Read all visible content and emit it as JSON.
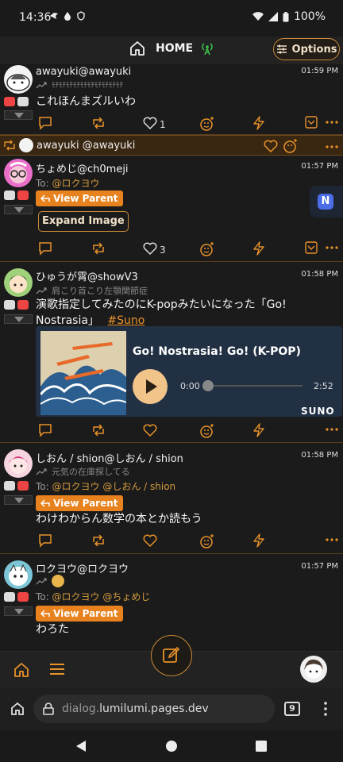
{
  "status": {
    "time": "14:36",
    "battery": "100%"
  },
  "header": {
    "title": "HOME",
    "options_label": "Options"
  },
  "posts": [
    {
      "name": "awayuki@awayuki",
      "time": "01:59 PM",
      "subtitle": "ﾓﾁﾓﾁﾓﾁﾓﾁﾓﾁﾓﾁﾓﾁﾓﾁﾓﾁﾓﾁ",
      "text": "これほんまズルいわ",
      "like_count": "1"
    },
    {
      "repost_by": "awayuki @awayuki",
      "name": "ちょめじ@ch0meji",
      "time": "01:57 PM",
      "to_prefix": "To:",
      "to": "@ロクヨウ",
      "view_parent": "View Parent",
      "expand_image": "Expand Image",
      "like_count": "3"
    },
    {
      "name": "ひゅうが霄@showV3",
      "time": "01:58 PM",
      "subtitle": "肩こり首こり左顎関節症",
      "text": "演歌指定してみたのにK-popみたいになった「Go! Nostrasia」",
      "hashtag": "#Suno",
      "card": {
        "title": "Go! Nostrasia! Go! (K-POP)",
        "time_start": "0:00",
        "time_end": "2:52",
        "brand": "SUNO"
      }
    },
    {
      "name": "しおん / shion@しおん / shion",
      "time": "01:58 PM",
      "subtitle": "元気の在庫探してる",
      "to_prefix": "To:",
      "to": "@ロクヨウ @しおん / shion",
      "view_parent": "View Parent",
      "text": "わけわからん数学の本とか読もう"
    },
    {
      "name": "ロクヨウ@ロクヨウ",
      "time": "01:57 PM",
      "to_prefix": "To:",
      "to": "@ロクヨウ @ちょめじ",
      "view_parent": "View Parent",
      "text": "わろた"
    }
  ],
  "browser": {
    "url_scheme": "dialog.",
    "url_host": "lumilumi.pages.dev",
    "tab_count": "9"
  },
  "colors": {
    "accent": "#e8922a",
    "background": "#1b1b1b",
    "card": "#223044"
  }
}
